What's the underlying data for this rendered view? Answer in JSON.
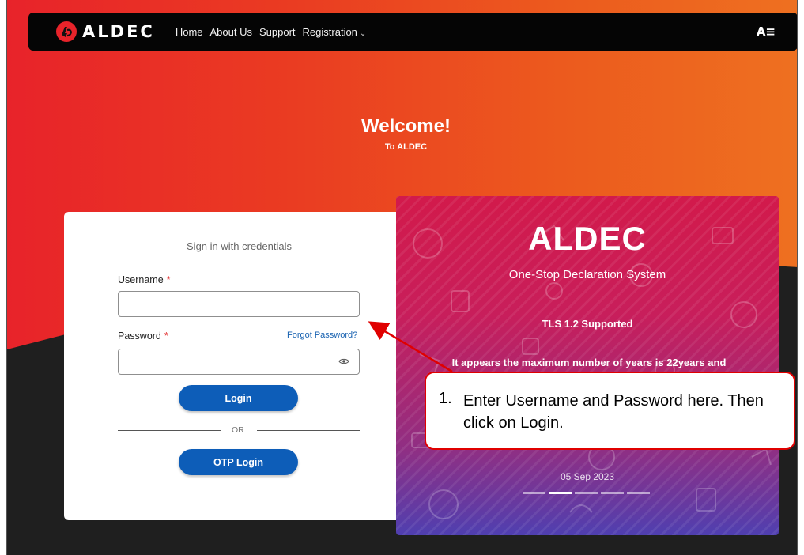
{
  "navbar": {
    "brand": "ALDEC",
    "links": [
      "Home",
      "About Us",
      "Support",
      "Registration"
    ],
    "accessibility_icon": "text-size-icon"
  },
  "hero": {
    "title": "Welcome!",
    "subtitle": "To ALDEC"
  },
  "login": {
    "caption": "Sign in with credentials",
    "username_label": "Username",
    "password_label": "Password",
    "required_mark": "*",
    "username_value": "",
    "password_value": "",
    "forgot_password": "Forgot Password?",
    "login_button": "Login",
    "or_text": "OR",
    "otp_button": "OTP Login"
  },
  "banner": {
    "title": "ALDEC",
    "subtitle": "One-Stop Declaration System",
    "tls": "TLS 1.2 Supported",
    "notice": "It appears the maximum number of years is 22years and",
    "date": "05 Sep 2023",
    "slides": 5,
    "active_slide": 2
  },
  "annotation": {
    "number": "1.",
    "text": "Enter Username and Password here. Then click on Login."
  },
  "colors": {
    "brand_red": "#e8232a",
    "button_blue": "#0d5db8",
    "callout_border": "#e00000"
  }
}
